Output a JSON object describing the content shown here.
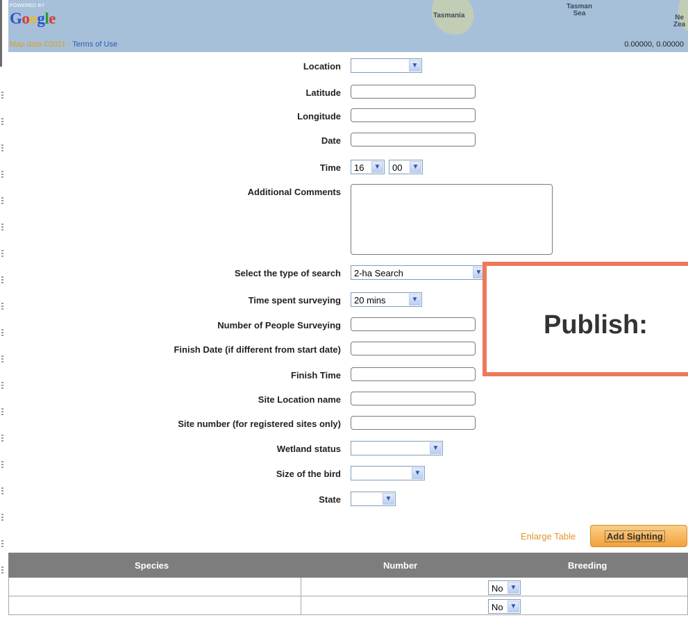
{
  "map": {
    "powered_by": "POWERED BY",
    "logo": "Google",
    "map_data": "Map data ©2011",
    "terms": "Terms of Use",
    "place_tasmania": "Tasmania",
    "place_tasman_sea": "Tasman\nSea",
    "place_nz": "Ne\nZea",
    "coordinates": "0.00000, 0.00000"
  },
  "form": {
    "location": {
      "label": "Location",
      "value": ""
    },
    "latitude": {
      "label": "Latitude",
      "value": ""
    },
    "longitude": {
      "label": "Longitude",
      "value": ""
    },
    "date": {
      "label": "Date",
      "value": ""
    },
    "time": {
      "label": "Time",
      "hour": "16",
      "minute": "00"
    },
    "comments": {
      "label": "Additional Comments",
      "value": ""
    },
    "search_type": {
      "label": "Select the type of search",
      "value": "2-ha Search"
    },
    "time_spent": {
      "label": "Time spent surveying",
      "value": "20 mins"
    },
    "num_people": {
      "label": "Number of People Surveying",
      "value": ""
    },
    "finish_date": {
      "label": "Finish Date (if different from start date)",
      "value": ""
    },
    "finish_time": {
      "label": "Finish Time",
      "value": ""
    },
    "site_location": {
      "label": "Site Location name",
      "value": ""
    },
    "site_number": {
      "label": "Site number (for registered sites only)",
      "value": ""
    },
    "wetland_status": {
      "label": "Wetland status",
      "value": ""
    },
    "bird_size": {
      "label": "Size of the bird",
      "value": ""
    },
    "state": {
      "label": "State",
      "value": ""
    }
  },
  "publish": {
    "label": "Publish:"
  },
  "actions": {
    "enlarge": "Enlarge Table",
    "add": "Add Sighting"
  },
  "table": {
    "headers": [
      "Species",
      "Number",
      "Breeding"
    ],
    "rows": [
      {
        "species": "",
        "number": "",
        "breeding": "No"
      },
      {
        "species": "",
        "number": "",
        "breeding": "No"
      }
    ]
  },
  "colors": {
    "accent_orange": "#f2a23a",
    "publish_border": "#ec7a5a",
    "table_header": "#7d7d7d",
    "map_water": "#a7c0d9"
  },
  "icons": {
    "select_arrow": "chevron-down-icon"
  }
}
